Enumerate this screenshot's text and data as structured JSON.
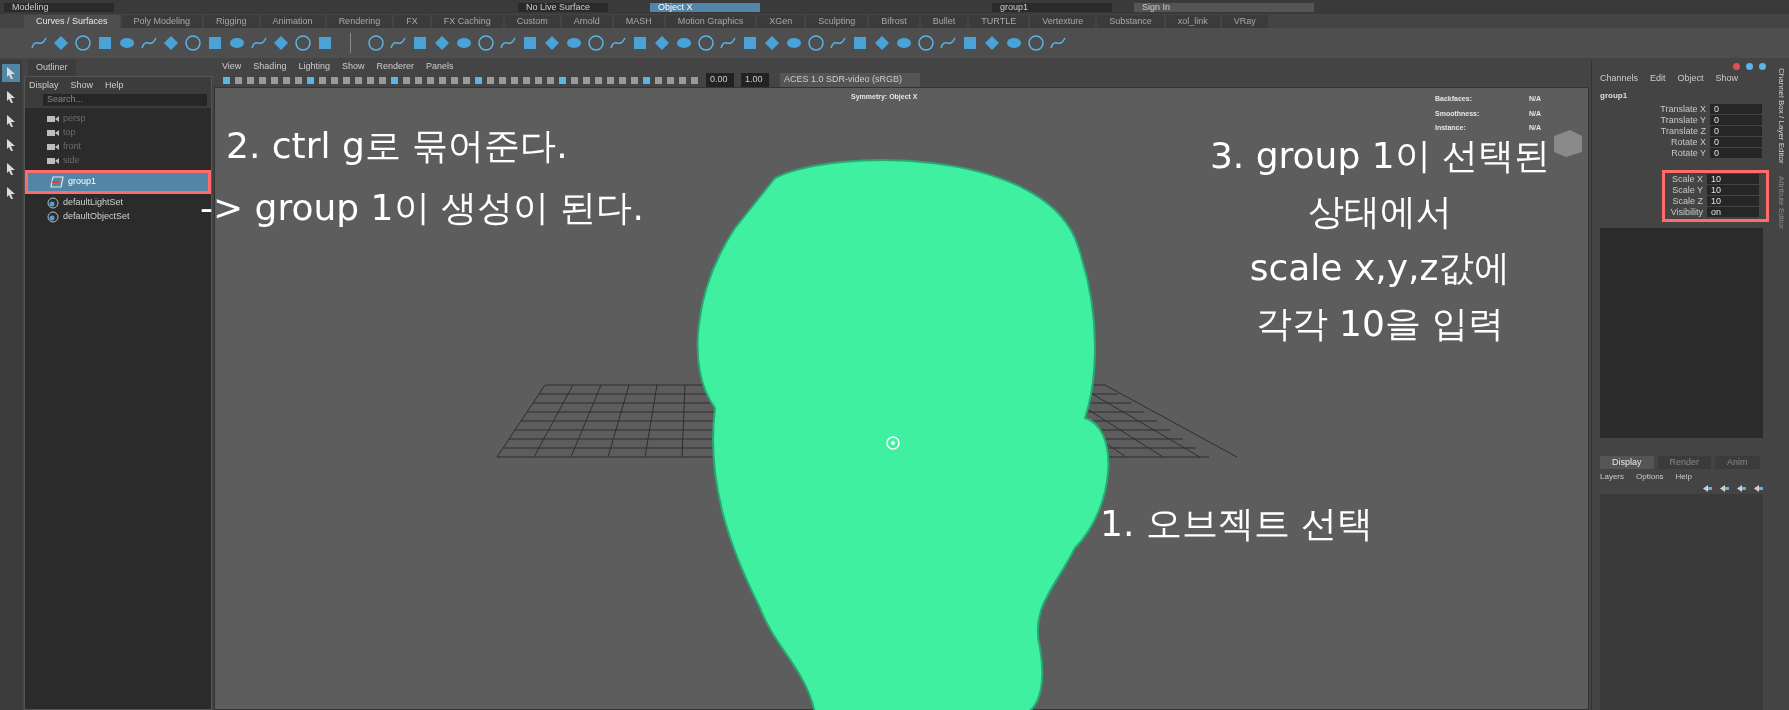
{
  "status_line": {
    "mode": "Modeling",
    "live_surface": "No Live Surface",
    "symmetry": "Object X",
    "name_field": "group1",
    "sign_in": "Sign In"
  },
  "shelf": {
    "tabs": [
      {
        "label": "Curves / Surfaces",
        "selected": true
      },
      {
        "label": "Poly Modeling",
        "selected": false
      },
      {
        "label": "Rigging",
        "selected": false
      },
      {
        "label": "Animation",
        "selected": false
      },
      {
        "label": "Rendering",
        "selected": false
      },
      {
        "label": "FX",
        "selected": false
      },
      {
        "label": "FX Caching",
        "selected": false
      },
      {
        "label": "Custom",
        "selected": false
      },
      {
        "label": "Arnold",
        "selected": false
      },
      {
        "label": "MASH",
        "selected": false
      },
      {
        "label": "Motion Graphics",
        "selected": false
      },
      {
        "label": "XGen",
        "selected": false
      },
      {
        "label": "Sculpting",
        "selected": false
      },
      {
        "label": "Bifrost",
        "selected": false
      },
      {
        "label": "Bullet",
        "selected": false
      },
      {
        "label": "TURTLE",
        "selected": false
      },
      {
        "label": "Vertexture",
        "selected": false
      },
      {
        "label": "Substance",
        "selected": false
      },
      {
        "label": "xol_link",
        "selected": false
      },
      {
        "label": "VRay",
        "selected": false
      }
    ]
  },
  "outliner": {
    "title": "Outliner",
    "menu": [
      "Display",
      "Show",
      "Help"
    ],
    "search": {
      "placeholder": "Search..."
    },
    "items": [
      {
        "label": "persp",
        "kind": "camera",
        "dimmed": true,
        "selected": false,
        "highlighted": false
      },
      {
        "label": "top",
        "kind": "camera",
        "dimmed": true,
        "selected": false,
        "highlighted": false
      },
      {
        "label": "front",
        "kind": "camera",
        "dimmed": true,
        "selected": false,
        "highlighted": false
      },
      {
        "label": "side",
        "kind": "camera",
        "dimmed": true,
        "selected": false,
        "highlighted": false
      },
      {
        "label": "group1",
        "kind": "group",
        "dimmed": false,
        "selected": true,
        "highlighted": true
      },
      {
        "label": "defaultLightSet",
        "kind": "set",
        "dimmed": false,
        "selected": false,
        "highlighted": false
      },
      {
        "label": "defaultObjectSet",
        "kind": "set",
        "dimmed": false,
        "selected": false,
        "highlighted": false
      }
    ]
  },
  "viewport": {
    "menu": [
      "View",
      "Shading",
      "Lighting",
      "Show",
      "Renderer",
      "Panels"
    ],
    "gamma": "0.00",
    "exposure": "1.00",
    "color_space": "ACES 1.0 SDR-video (sRGB)",
    "symmetry_label": "Symmetry: Object X",
    "hud": [
      {
        "label": "Backfaces:",
        "value": "N/A"
      },
      {
        "label": "Smoothness:",
        "value": "N/A"
      },
      {
        "label": "Instance:",
        "value": "N/A"
      }
    ]
  },
  "channel_box": {
    "menu": [
      "Channels",
      "Edit",
      "Object",
      "Show"
    ],
    "object": "group1",
    "attributes": [
      {
        "name": "Translate X",
        "value": "0",
        "highlighted": false
      },
      {
        "name": "Translate Y",
        "value": "0",
        "highlighted": false
      },
      {
        "name": "Translate Z",
        "value": "0",
        "highlighted": false
      },
      {
        "name": "Rotate X",
        "value": "0",
        "highlighted": false
      },
      {
        "name": "Rotate Y",
        "value": "0",
        "highlighted": false
      },
      {
        "name": "Scale X",
        "value": "10",
        "highlighted": true
      },
      {
        "name": "Scale Y",
        "value": "10",
        "highlighted": true
      },
      {
        "name": "Scale Z",
        "value": "10",
        "highlighted": true
      },
      {
        "name": "Visibility",
        "value": "on",
        "highlighted": true
      }
    ],
    "side_tabs": [
      "Channel Box / Layer Editor",
      "Attribute Editor"
    ]
  },
  "layer_editor": {
    "tabs": [
      {
        "label": "Display",
        "selected": true
      },
      {
        "label": "Render",
        "selected": false
      },
      {
        "label": "Anim",
        "selected": false
      }
    ],
    "menu": [
      "Layers",
      "Options",
      "Help"
    ]
  },
  "annotations": {
    "step2": [
      "2. ctrl g로 묶어준다.",
      "-> group 1이 생성이 된다."
    ],
    "step3": [
      "3. group 1이 선택된",
      "상태에서",
      "scale x,y,z값에",
      "각각 10을 입력"
    ],
    "step1": "1. 오브젝트 선택"
  }
}
